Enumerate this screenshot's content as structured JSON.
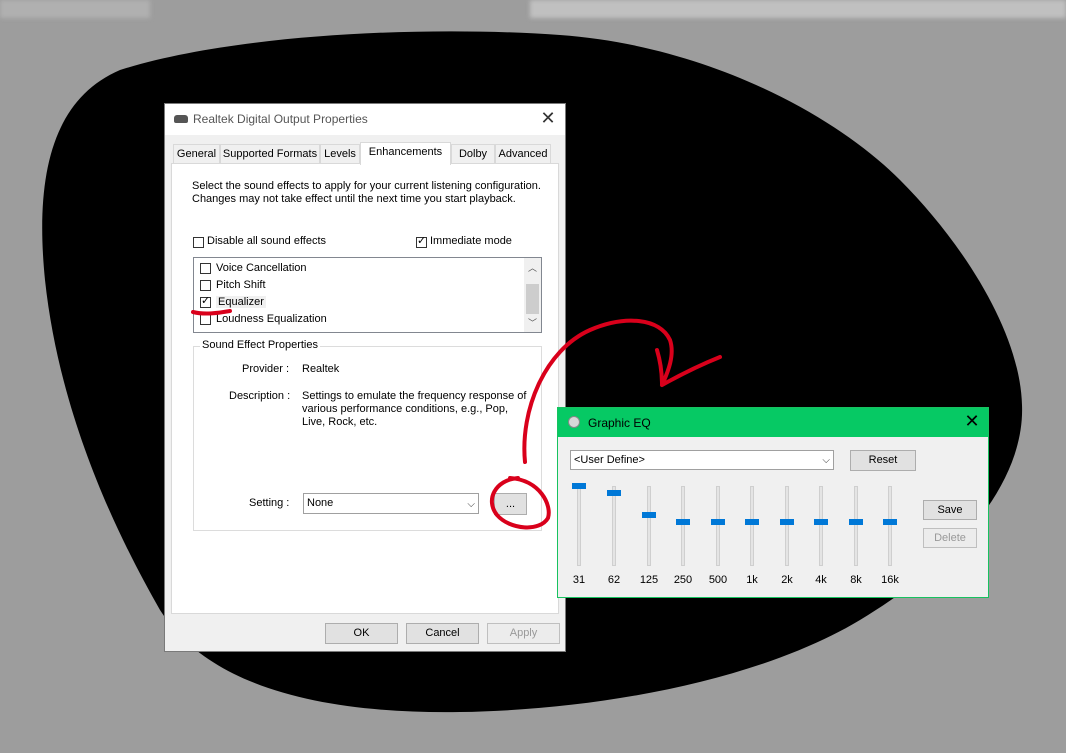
{
  "dialog": {
    "title": "Realtek Digital Output Properties",
    "close_glyph": "✕",
    "tabs": [
      "General",
      "Supported Formats",
      "Levels",
      "Enhancements",
      "Dolby",
      "Advanced"
    ],
    "active_tab": "Enhancements",
    "intro_text": "Select the sound effects to apply for your current listening configuration. Changes may not take effect until the next time you start playback.",
    "disable_all_label": "Disable all sound effects",
    "disable_all_checked": false,
    "immediate_mode_label": "Immediate mode",
    "immediate_mode_checked": true,
    "effects": [
      {
        "label": "Voice Cancellation",
        "checked": false
      },
      {
        "label": "Pitch Shift",
        "checked": false
      },
      {
        "label": "Equalizer",
        "checked": true
      },
      {
        "label": "Loudness Equalization",
        "checked": false
      }
    ],
    "group_title": "Sound Effect Properties",
    "provider_label": "Provider :",
    "provider_value": "Realtek",
    "description_label": "Description :",
    "description_value": "Settings to emulate the frequency response of various performance conditions,  e.g., Pop, Live, Rock, etc.",
    "setting_label": "Setting :",
    "setting_value": "None",
    "more_button": "...",
    "ok_button": "OK",
    "cancel_button": "Cancel",
    "apply_button": "Apply"
  },
  "eq": {
    "title": "Graphic EQ",
    "close_glyph": "✕",
    "preset_value": "<User Define>",
    "reset_button": "Reset",
    "save_button": "Save",
    "delete_button": "Delete",
    "bands": [
      {
        "label": "31",
        "level": 1.0
      },
      {
        "label": "62",
        "level": 0.9
      },
      {
        "label": "125",
        "level": 0.6
      },
      {
        "label": "250",
        "level": 0.5
      },
      {
        "label": "500",
        "level": 0.5
      },
      {
        "label": "1k",
        "level": 0.5
      },
      {
        "label": "2k",
        "level": 0.5
      },
      {
        "label": "4k",
        "level": 0.5
      },
      {
        "label": "8k",
        "level": 0.5
      },
      {
        "label": "16k",
        "level": 0.5
      }
    ]
  },
  "colors": {
    "eq_title_bar": "#06c964",
    "slider_thumb": "#0078d7",
    "annotation_red": "#d9001b"
  }
}
